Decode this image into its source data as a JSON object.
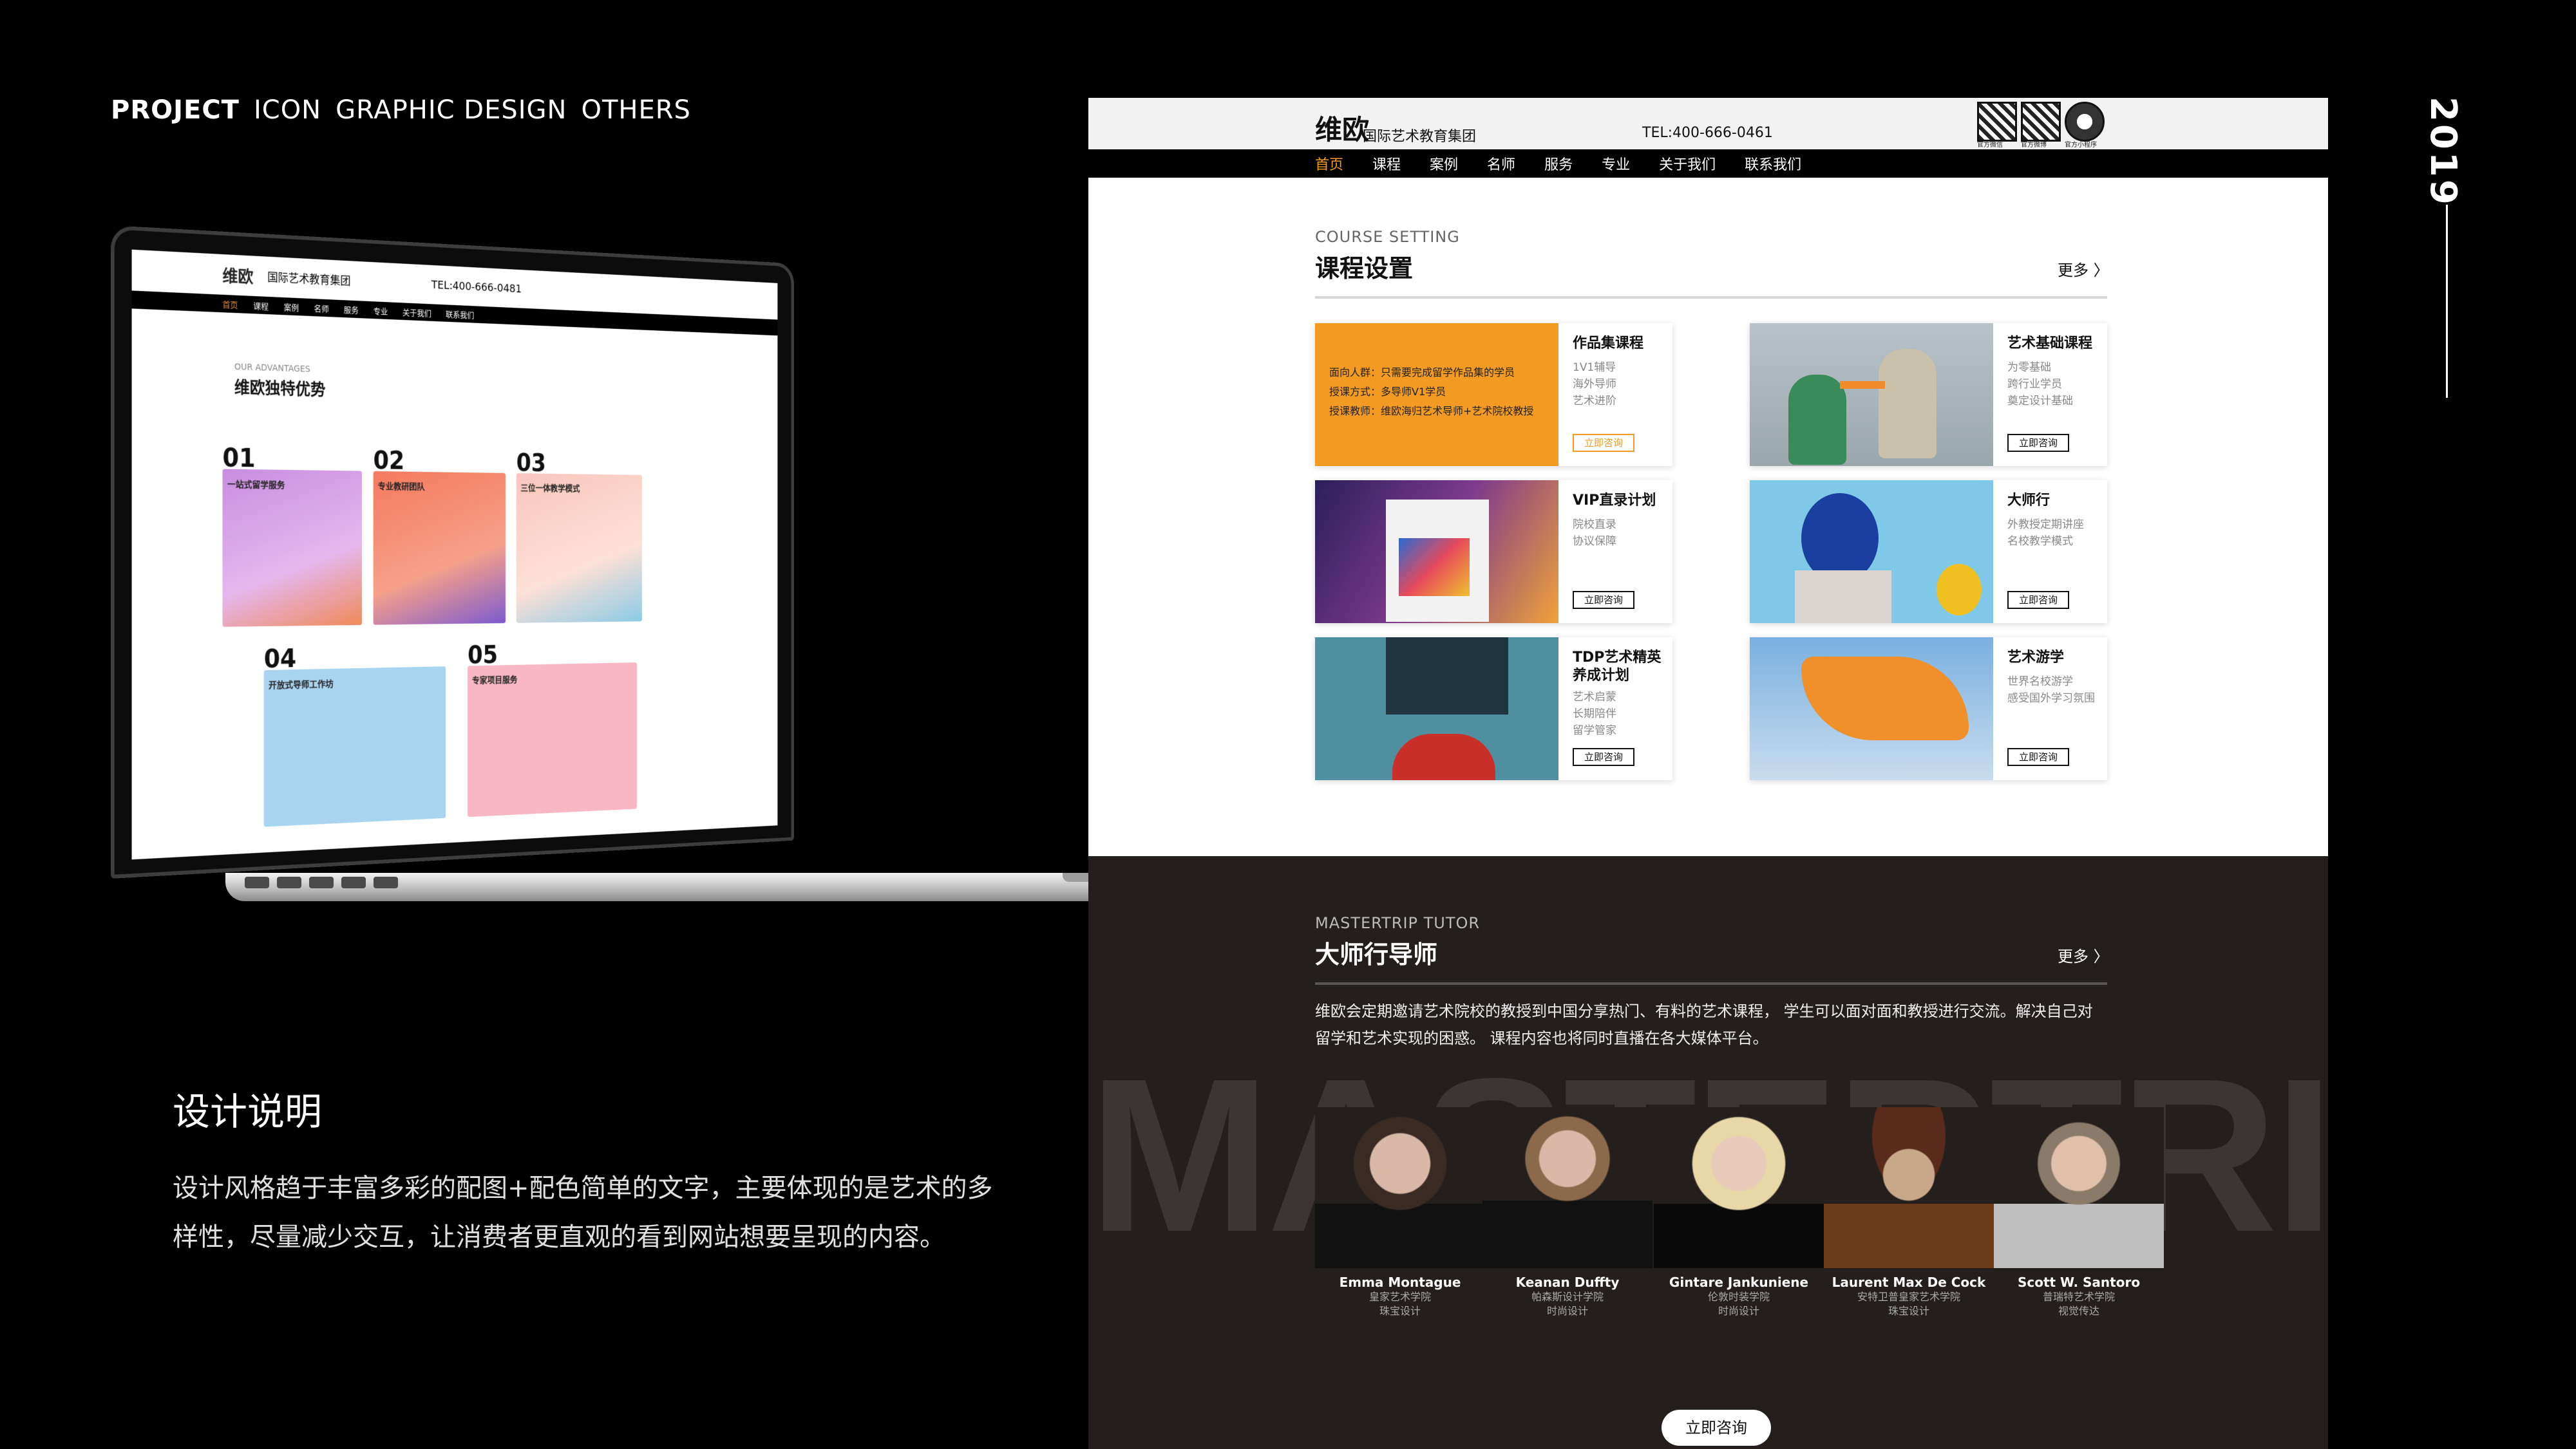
{
  "topnav": {
    "items": [
      "PROJECT",
      "ICON",
      "GRAPHIC DESIGN",
      "OTHERS"
    ]
  },
  "year": "2019",
  "laptop": {
    "logo": "维欧",
    "org": "国际艺术教育集团",
    "tel": "TEL:400-666-0481",
    "nav": [
      "首页",
      "课程",
      "案例",
      "名师",
      "服务",
      "专业",
      "关于我们",
      "联系我们"
    ],
    "section_sub": "OUR ADVANTAGES",
    "section_title": "维欧独特优势",
    "cards": [
      {
        "num": "01",
        "title": "一站式留学服务"
      },
      {
        "num": "02",
        "title": "专业教研团队"
      },
      {
        "num": "03",
        "title": "三位一体教学模式"
      },
      {
        "num": "04",
        "title": "开放式导师工作坊"
      },
      {
        "num": "05",
        "title": "专家项目服务"
      }
    ]
  },
  "web": {
    "logo": "维欧",
    "org": "国际艺术教育集团",
    "tel": "TEL:400-666-0461",
    "qr_labels": [
      "官方微信",
      "官方微博",
      "官方小程序"
    ],
    "nav": [
      "首页",
      "课程",
      "案例",
      "名师",
      "服务",
      "专业",
      "关于我们",
      "联系我们"
    ],
    "course": {
      "sub": "COURSE SETTING",
      "title": "课程设置",
      "more": "更多 〉",
      "items": [
        {
          "title": "作品集课程",
          "desc": [
            "1V1辅导",
            "海外导师",
            "艺术进阶"
          ],
          "btn": "立即咨询",
          "promo": [
            "面向人群：只需要完成留学作品集的学员",
            "授课方式：多导师V1学员",
            "授课教师：维欧海归艺术导师+艺术院校教授"
          ]
        },
        {
          "title": "艺术基础课程",
          "desc": [
            "为零基础",
            "跨行业学员",
            "奠定设计基础"
          ],
          "btn": "立即咨询"
        },
        {
          "title": "VIP直录计划",
          "desc": [
            "院校直录",
            "协议保障"
          ],
          "btn": "立即咨询"
        },
        {
          "title": "大师行",
          "desc": [
            "外教授定期讲座",
            "名校教学模式"
          ],
          "btn": "立即咨询"
        },
        {
          "title": "TDP艺术精英养成计划",
          "desc": [
            "艺术启蒙",
            "长期陪伴",
            "留学管家"
          ],
          "btn": "立即咨询"
        },
        {
          "title": "艺术游学",
          "desc": [
            "世界名校游学",
            "感受国外学习氛围"
          ],
          "btn": "立即咨询"
        }
      ]
    },
    "master": {
      "sub": "MASTERTRIP TUTOR",
      "title": "大师行导师",
      "more": "更多 〉",
      "intro": "维欧会定期邀请艺术院校的教授到中国分享热门、有料的艺术课程， 学生可以面对面和教授进行交流。解决自己对留学和艺术实现的困惑。 课程内容也将同时直播在各大媒体平台。",
      "bg_word": "MASTERTRIP",
      "tutors": [
        {
          "name": "Emma Montague",
          "school": "皇家艺术学院",
          "major": "珠宝设计"
        },
        {
          "name": "Keanan Duffty",
          "school": "帕森斯设计学院",
          "major": "时尚设计"
        },
        {
          "name": "Gintare Jankuniene",
          "school": "伦敦时装学院",
          "major": "时尚设计"
        },
        {
          "name": "Laurent Max De Cock",
          "school": "安特卫普皇家艺术学院",
          "major": "珠宝设计"
        },
        {
          "name": "Scott W. Santoro",
          "school": "普瑞特艺术学院",
          "major": "视觉传达"
        }
      ],
      "cta": "立即咨询"
    }
  },
  "description": {
    "title": "设计说明",
    "text": "设计风格趋于丰富多彩的配图+配色简单的文字，主要体现的是艺术的多样性，尽量减少交互，让消费者更直观的看到网站想要呈现的内容。"
  },
  "colors": {
    "accent": "#f39a23",
    "dark": "#241f1d",
    "bg": "#000000"
  }
}
